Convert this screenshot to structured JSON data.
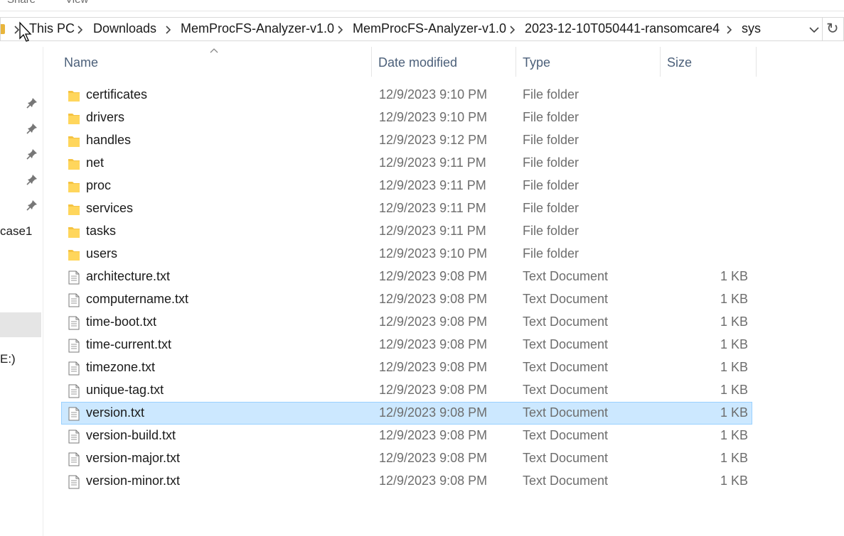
{
  "ribbon": {
    "share_label": "Share",
    "view_label": "View"
  },
  "address_bar": {
    "crumbs": [
      "This PC",
      "Downloads",
      "MemProcFS-Analyzer-v1.0",
      "MemProcFS-Analyzer-v1.0",
      "2023-12-10T050441-ransomcare4",
      "sys"
    ],
    "refresh_icon": "↻"
  },
  "nav": {
    "labels": [
      "case1",
      "E:)"
    ]
  },
  "columns": {
    "name": "Name",
    "date": "Date modified",
    "type": "Type",
    "size": "Size"
  },
  "files": [
    {
      "name": "certificates",
      "date": "12/9/2023 9:10 PM",
      "type": "File folder",
      "size": "",
      "icon": "folder-icon"
    },
    {
      "name": "drivers",
      "date": "12/9/2023 9:10 PM",
      "type": "File folder",
      "size": "",
      "icon": "folder-icon"
    },
    {
      "name": "handles",
      "date": "12/9/2023 9:12 PM",
      "type": "File folder",
      "size": "",
      "icon": "folder-icon"
    },
    {
      "name": "net",
      "date": "12/9/2023 9:11 PM",
      "type": "File folder",
      "size": "",
      "icon": "folder-icon"
    },
    {
      "name": "proc",
      "date": "12/9/2023 9:11 PM",
      "type": "File folder",
      "size": "",
      "icon": "folder-icon"
    },
    {
      "name": "services",
      "date": "12/9/2023 9:11 PM",
      "type": "File folder",
      "size": "",
      "icon": "folder-icon"
    },
    {
      "name": "tasks",
      "date": "12/9/2023 9:11 PM",
      "type": "File folder",
      "size": "",
      "icon": "folder-icon"
    },
    {
      "name": "users",
      "date": "12/9/2023 9:10 PM",
      "type": "File folder",
      "size": "",
      "icon": "folder-icon"
    },
    {
      "name": "architecture.txt",
      "date": "12/9/2023 9:08 PM",
      "type": "Text Document",
      "size": "1 KB",
      "icon": "text-file-icon"
    },
    {
      "name": "computername.txt",
      "date": "12/9/2023 9:08 PM",
      "type": "Text Document",
      "size": "1 KB",
      "icon": "text-file-icon"
    },
    {
      "name": "time-boot.txt",
      "date": "12/9/2023 9:08 PM",
      "type": "Text Document",
      "size": "1 KB",
      "icon": "text-file-icon"
    },
    {
      "name": "time-current.txt",
      "date": "12/9/2023 9:08 PM",
      "type": "Text Document",
      "size": "1 KB",
      "icon": "text-file-icon"
    },
    {
      "name": "timezone.txt",
      "date": "12/9/2023 9:08 PM",
      "type": "Text Document",
      "size": "1 KB",
      "icon": "text-file-icon"
    },
    {
      "name": "unique-tag.txt",
      "date": "12/9/2023 9:08 PM",
      "type": "Text Document",
      "size": "1 KB",
      "icon": "text-file-icon"
    },
    {
      "name": "version.txt",
      "date": "12/9/2023 9:08 PM",
      "type": "Text Document",
      "size": "1 KB",
      "icon": "text-file-icon",
      "selected": true
    },
    {
      "name": "version-build.txt",
      "date": "12/9/2023 9:08 PM",
      "type": "Text Document",
      "size": "1 KB",
      "icon": "text-file-icon"
    },
    {
      "name": "version-major.txt",
      "date": "12/9/2023 9:08 PM",
      "type": "Text Document",
      "size": "1 KB",
      "icon": "text-file-icon"
    },
    {
      "name": "version-minor.txt",
      "date": "12/9/2023 9:08 PM",
      "type": "Text Document",
      "size": "1 KB",
      "icon": "text-file-icon"
    }
  ],
  "colors": {
    "selection_bg": "#cce8ff",
    "selection_border": "#99d1ff",
    "folder": "#f5c342",
    "header_text": "#4c607a"
  }
}
